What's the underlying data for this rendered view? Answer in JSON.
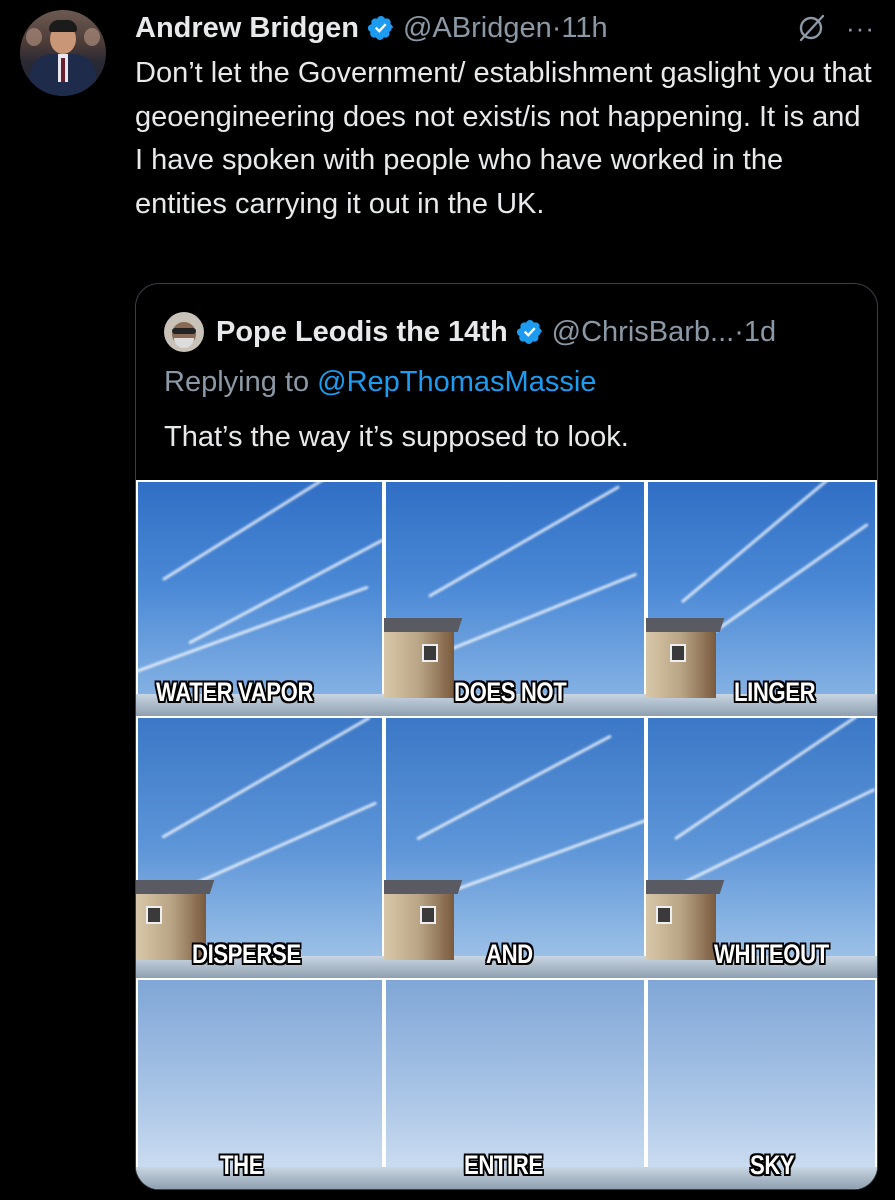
{
  "tweet": {
    "author_name": "Andrew Bridgen",
    "handle": "@ABridgen",
    "separator": "·",
    "time": "11h",
    "more_label": "···",
    "text": "Don’t let the Government/ establishment gaslight you that geoengineering does not exist/is not happening. It is and I have spoken with people who have worked in the entities carrying it out in the UK."
  },
  "quote": {
    "author_name": "Pope Leodis the 14th",
    "handle": "@ChrisBarb...",
    "separator": "·",
    "time": "1d",
    "replying_prefix": "Replying to ",
    "replying_to": "@RepThomasMassie",
    "text": "That’s the way it’s supposed to look.",
    "image_captions": [
      "WATER VAPOR",
      "DOES NOT",
      "LINGER",
      "DISPERSE",
      "AND",
      "WHITEOUT",
      "THE",
      "ENTIRE",
      "SKY"
    ]
  },
  "colors": {
    "background": "#000000",
    "text": "#e7e9ea",
    "secondary": "#8b98a5",
    "link": "#1d9bf0",
    "verified": "#1d9bf0"
  },
  "icons": [
    "verified-badge-icon",
    "grok-icon",
    "more-icon"
  ]
}
